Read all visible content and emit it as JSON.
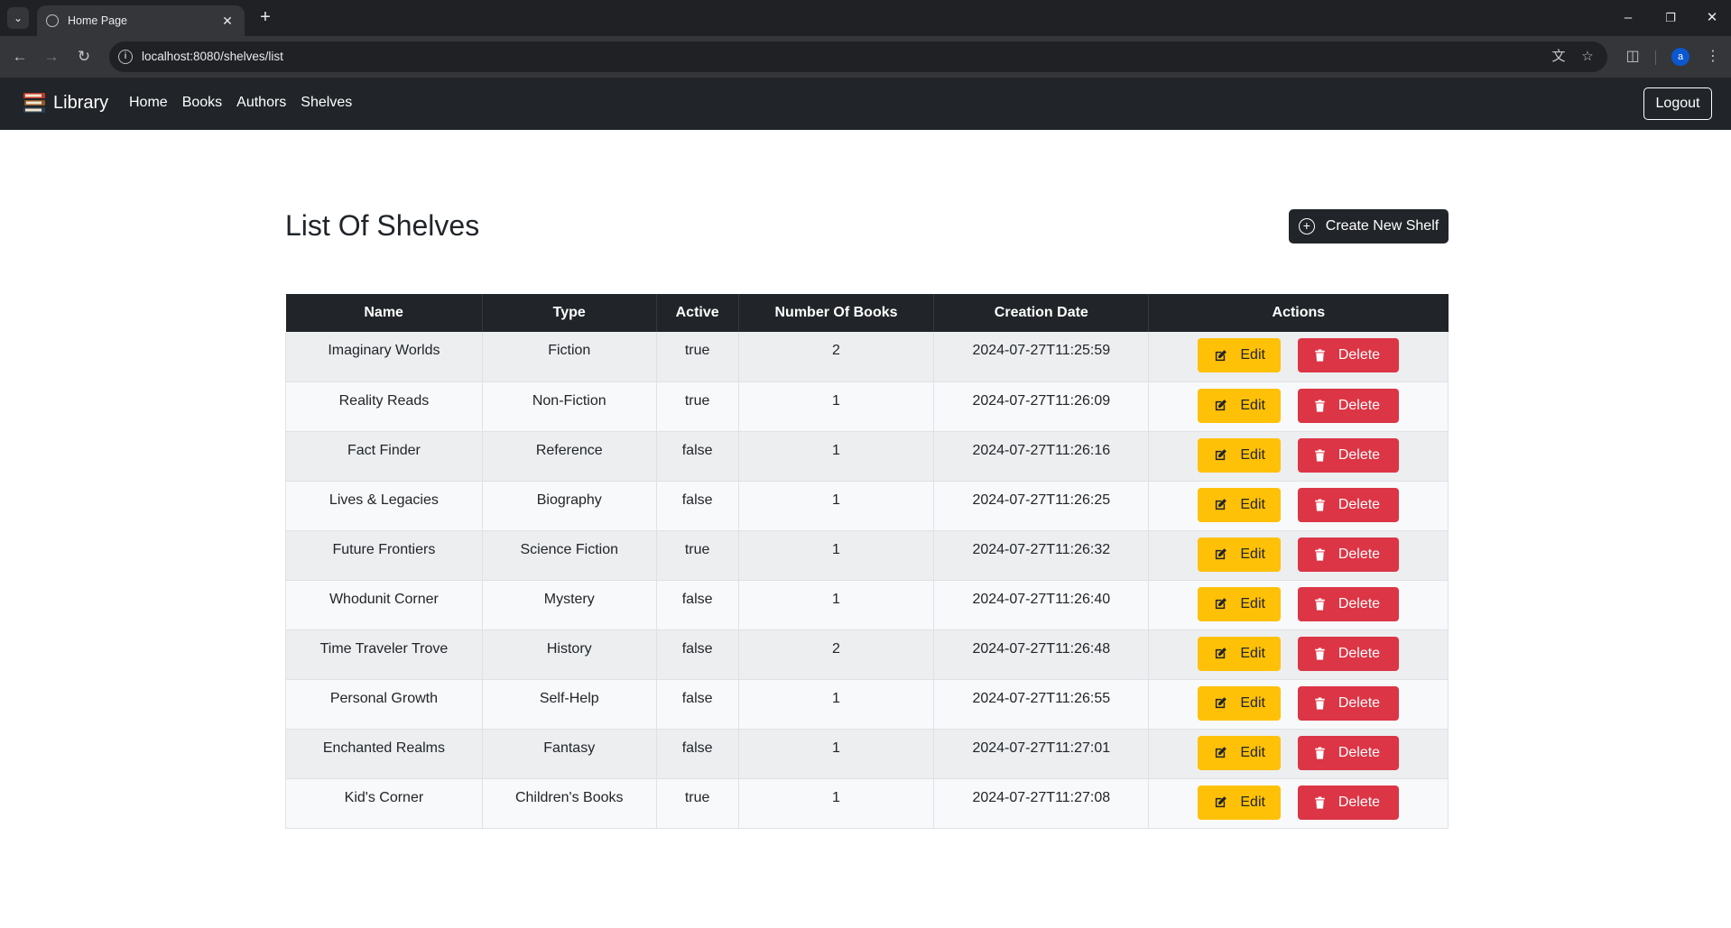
{
  "browser": {
    "tab_title": "Home Page",
    "url": "localhost:8080/shelves/list",
    "profile_initial": "a"
  },
  "navbar": {
    "brand": "Library",
    "links": [
      "Home",
      "Books",
      "Authors",
      "Shelves"
    ],
    "logout_label": "Logout"
  },
  "page": {
    "title": "List Of Shelves",
    "create_label": "Create New Shelf"
  },
  "table": {
    "headers": [
      "Name",
      "Type",
      "Active",
      "Number Of Books",
      "Creation Date",
      "Actions"
    ],
    "edit_label": "Edit",
    "delete_label": "Delete",
    "rows": [
      {
        "name": "Imaginary Worlds",
        "type": "Fiction",
        "active": "true",
        "books": "2",
        "date": "2024-07-27T11:25:59"
      },
      {
        "name": "Reality Reads",
        "type": "Non-Fiction",
        "active": "true",
        "books": "1",
        "date": "2024-07-27T11:26:09"
      },
      {
        "name": "Fact Finder",
        "type": "Reference",
        "active": "false",
        "books": "1",
        "date": "2024-07-27T11:26:16"
      },
      {
        "name": "Lives & Legacies",
        "type": "Biography",
        "active": "false",
        "books": "1",
        "date": "2024-07-27T11:26:25"
      },
      {
        "name": "Future Frontiers",
        "type": "Science Fiction",
        "active": "true",
        "books": "1",
        "date": "2024-07-27T11:26:32"
      },
      {
        "name": "Whodunit Corner",
        "type": "Mystery",
        "active": "false",
        "books": "1",
        "date": "2024-07-27T11:26:40"
      },
      {
        "name": "Time Traveler Trove",
        "type": "History",
        "active": "false",
        "books": "2",
        "date": "2024-07-27T11:26:48"
      },
      {
        "name": "Personal Growth",
        "type": "Self-Help",
        "active": "false",
        "books": "1",
        "date": "2024-07-27T11:26:55"
      },
      {
        "name": "Enchanted Realms",
        "type": "Fantasy",
        "active": "false",
        "books": "1",
        "date": "2024-07-27T11:27:01"
      },
      {
        "name": "Kid's Corner",
        "type": "Children's Books",
        "active": "true",
        "books": "1",
        "date": "2024-07-27T11:27:08"
      }
    ]
  },
  "colors": {
    "navbar_bg": "#212529",
    "edit_button": "#ffc107",
    "delete_button": "#dc3545"
  }
}
